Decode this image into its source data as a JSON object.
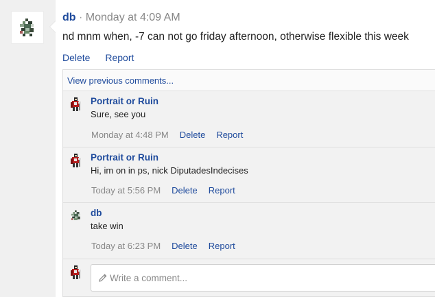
{
  "post": {
    "author": "db",
    "separator": "·",
    "timestamp": "Monday at 4:09 AM",
    "body": "nd mnm when, -7 can not go friday afternoon, otherwise flexible this week",
    "actions": {
      "delete": "Delete",
      "report": "Report"
    }
  },
  "comments_section": {
    "view_previous": "View previous comments...",
    "comments": [
      {
        "author": "Portrait or Ruin",
        "text": "Sure, see you",
        "timestamp": "Monday at 4:48 PM",
        "delete": "Delete",
        "report": "Report",
        "avatar": "knight-avatar"
      },
      {
        "author": "Portrait or Ruin",
        "text": "Hi, im on in ps, nick DiputadesIndecises",
        "timestamp": "Today at 5:56 PM",
        "delete": "Delete",
        "report": "Report",
        "avatar": "knight-avatar"
      },
      {
        "author": "db",
        "text": "take win",
        "timestamp": "Today at 6:23 PM",
        "delete": "Delete",
        "report": "Report",
        "avatar": "pixel-sprite-avatar"
      }
    ],
    "composer": {
      "placeholder": "Write a comment...",
      "value": ""
    }
  },
  "colors": {
    "link": "#1e4a9c",
    "muted": "#888888",
    "text": "#222222",
    "panel": "#f2f2f2"
  }
}
